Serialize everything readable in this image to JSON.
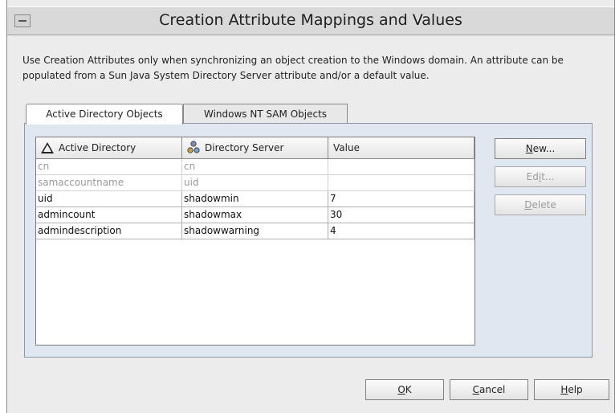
{
  "window": {
    "title": "Creation Attribute Mappings and Values"
  },
  "description": "Use Creation Attributes only when synchronizing an object creation to the Windows domain.  An attribute can be populated from a Sun Java System Directory Server attribute and/or a default value.",
  "tabs": [
    {
      "label": "Active Directory Objects",
      "active": true
    },
    {
      "label": "Windows NT SAM Objects",
      "active": false
    }
  ],
  "table": {
    "columns": [
      {
        "label": "Active Directory",
        "icon": "sort-ascending-icon"
      },
      {
        "label": "Directory Server",
        "icon": "directory-server-icon"
      },
      {
        "label": "Value"
      }
    ],
    "rows": [
      {
        "ad": "cn",
        "ds": "cn",
        "value": "",
        "disabled": true
      },
      {
        "ad": "samaccountname",
        "ds": "uid",
        "value": "",
        "disabled": true
      },
      {
        "ad": "uid",
        "ds": "shadowmin",
        "value": "7",
        "disabled": false
      },
      {
        "ad": "admincount",
        "ds": "shadowmax",
        "value": "30",
        "disabled": false
      },
      {
        "ad": "admindescription",
        "ds": "shadowwarning",
        "value": "4",
        "disabled": false
      }
    ]
  },
  "side_buttons": {
    "new": {
      "mnemonic": "N",
      "rest": "ew..."
    },
    "edit": {
      "pre": "Ed",
      "mnemonic": "i",
      "rest": "t..."
    },
    "delete": {
      "mnemonic": "D",
      "rest": "elete"
    }
  },
  "footer_buttons": {
    "ok": {
      "mnemonic": "O",
      "rest": "K"
    },
    "cancel": {
      "mnemonic": "C",
      "rest": "ancel"
    },
    "help": {
      "mnemonic": "H",
      "rest": "elp"
    }
  }
}
